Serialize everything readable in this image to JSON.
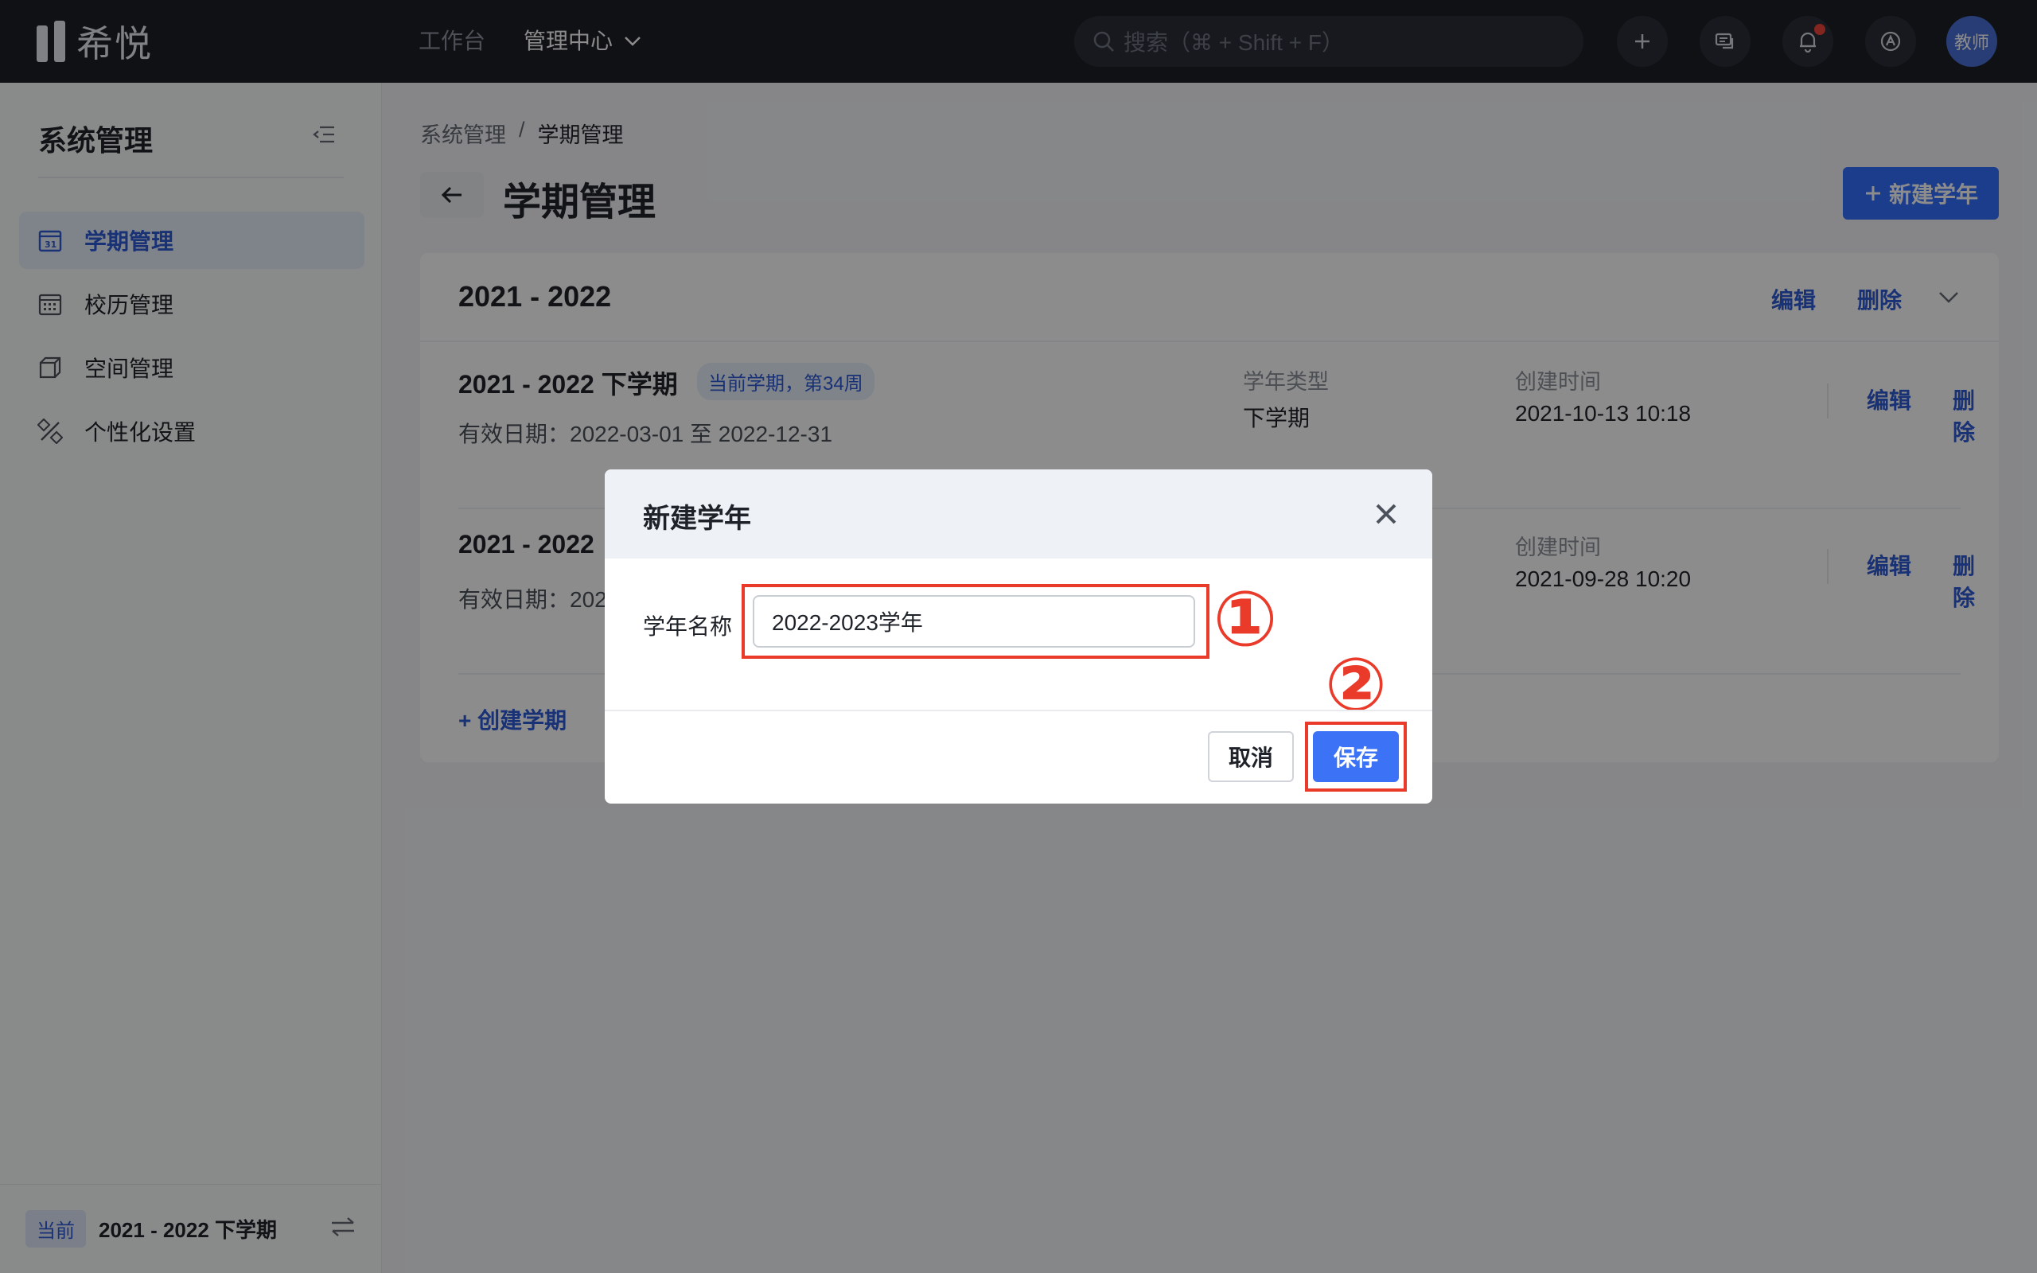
{
  "topbar": {
    "brand": "希悦",
    "nav": {
      "workbench": "工作台",
      "admin": "管理中心"
    },
    "search_placeholder": "搜索（⌘ + Shift + F）",
    "avatar_label": "教师"
  },
  "sidebar": {
    "title": "系统管理",
    "items": [
      {
        "label": "学期管理",
        "icon": "calendar-icon",
        "active": true
      },
      {
        "label": "校历管理",
        "icon": "calendar-grid-icon",
        "active": false
      },
      {
        "label": "空间管理",
        "icon": "cube-icon",
        "active": false
      },
      {
        "label": "个性化设置",
        "icon": "brush-ruler-icon",
        "active": false
      }
    ],
    "footer": {
      "badge": "当前",
      "term": "2021 - 2022 下学期"
    }
  },
  "main": {
    "breadcrumb": [
      "系统管理",
      "/",
      "学期管理"
    ],
    "title": "学期管理",
    "new_year_button": "新建学年",
    "card": {
      "year": "2021 - 2022",
      "edit": "编辑",
      "delete": "删除",
      "rows": [
        {
          "name": "2021 - 2022 下学期",
          "tag": "当前学期，第34周",
          "date": "有效日期：2022-03-01 至 2022-12-31",
          "type_label": "学年类型",
          "type_value": "下学期",
          "created_label": "创建时间",
          "created_value": "2021-10-13 10:18",
          "edit": "编辑",
          "delete": "删除"
        },
        {
          "name": "2021 - 2022",
          "date": "有效日期：202",
          "created_label": "创建时间",
          "created_value": "2021-09-28 10:20",
          "edit": "编辑",
          "delete": "删除"
        }
      ],
      "create_term": "创建学期"
    }
  },
  "modal": {
    "title": "新建学年",
    "field_label": "学年名称",
    "field_value": "2022-2023学年",
    "cancel": "取消",
    "save": "保存",
    "annotation_1": "①",
    "annotation_2": "②"
  },
  "colors": {
    "accent": "#3370ff",
    "highlight": "#ea3a2a",
    "topbar": "#1c1f26"
  }
}
